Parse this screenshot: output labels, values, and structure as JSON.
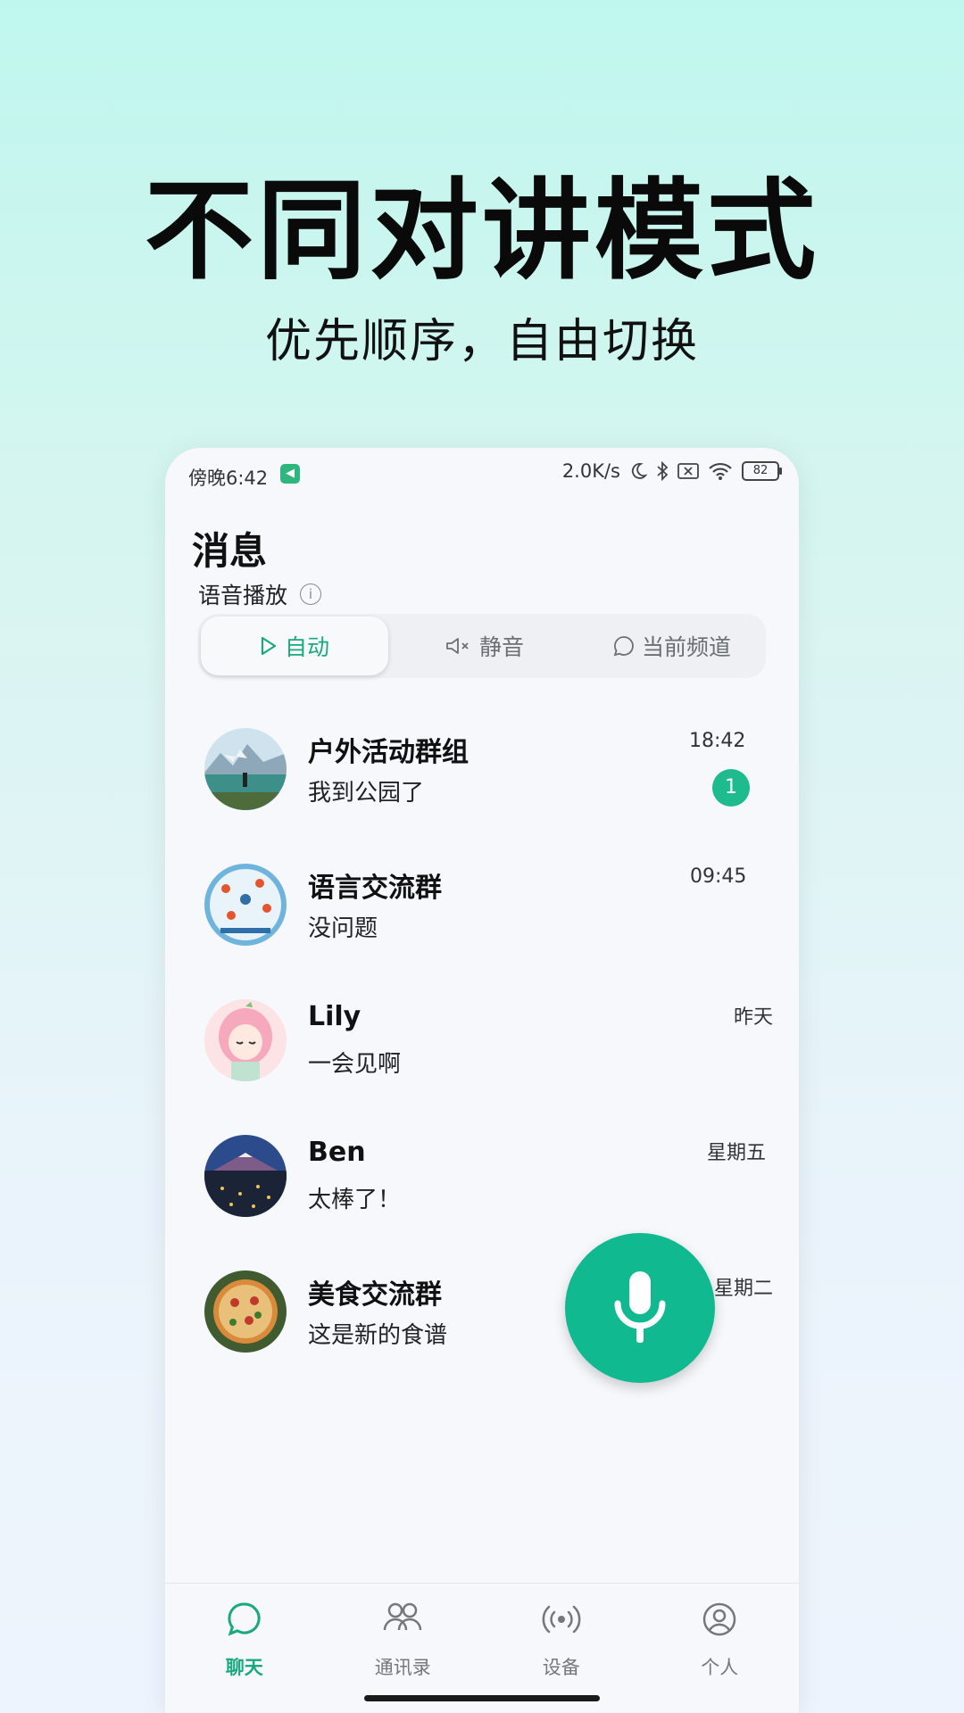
{
  "hero": {
    "title": "不同对讲模式",
    "subtitle": "优先顺序，自由切换"
  },
  "status_bar": {
    "time": "傍晚6:42",
    "speed": "2.0K/s",
    "battery": "82"
  },
  "page": {
    "title": "消息"
  },
  "voice_playback": {
    "label": "语音播放",
    "options": [
      {
        "label": "自动",
        "icon": "play-icon",
        "selected": true
      },
      {
        "label": "静音",
        "icon": "mute-icon",
        "selected": false
      },
      {
        "label": "当前频道",
        "icon": "chat-bubble-icon",
        "selected": false
      }
    ]
  },
  "chats": [
    {
      "name": "户外活动群组",
      "message": "我到公园了",
      "time": "18:42",
      "unread": "1"
    },
    {
      "name": "语言交流群",
      "message": "没问题",
      "time": "09:45"
    },
    {
      "name": "Lily",
      "message": "一会见啊",
      "time": "昨天"
    },
    {
      "name": "Ben",
      "message": "太棒了！",
      "time": "星期五"
    },
    {
      "name": "美食交流群",
      "message": "这是新的食谱",
      "time": "星期二"
    }
  ],
  "tabs": [
    {
      "label": "聊天",
      "icon": "chat-icon",
      "active": true
    },
    {
      "label": "通讯录",
      "icon": "contacts-icon",
      "active": false
    },
    {
      "label": "设备",
      "icon": "device-icon",
      "active": false
    },
    {
      "label": "个人",
      "icon": "profile-icon",
      "active": false
    }
  ],
  "colors": {
    "accent": "#10b98f",
    "accent_text": "#1aa880"
  }
}
